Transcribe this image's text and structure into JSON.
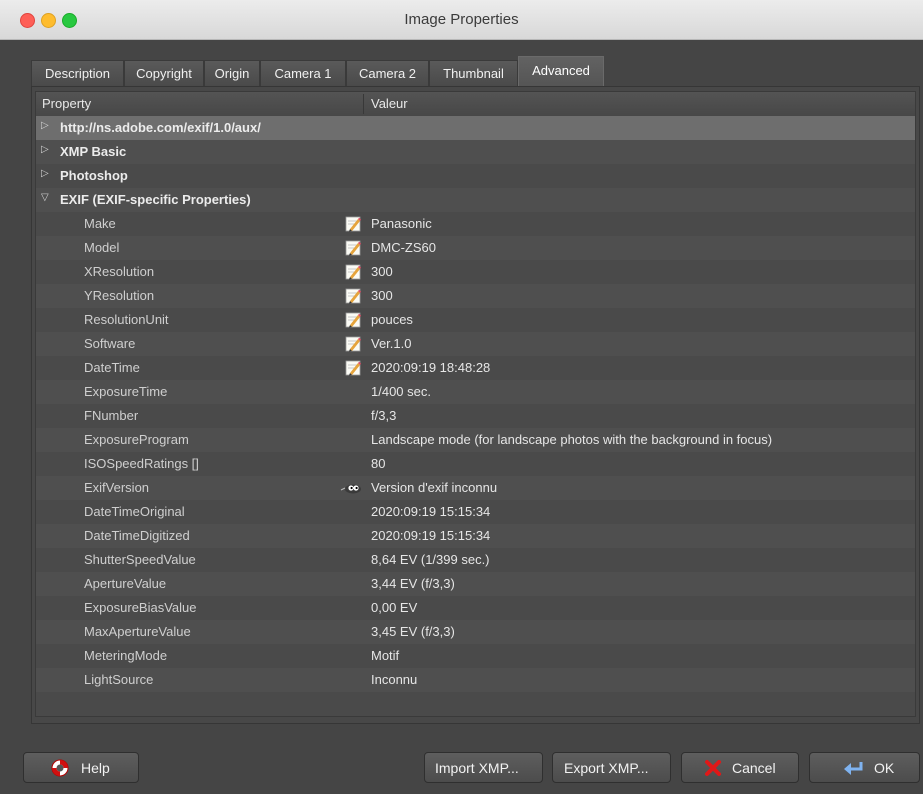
{
  "window": {
    "title": "Image Properties"
  },
  "tabs": [
    {
      "label": "Description",
      "active": false
    },
    {
      "label": "Copyright",
      "active": false
    },
    {
      "label": "Origin",
      "active": false
    },
    {
      "label": "Camera 1",
      "active": false
    },
    {
      "label": "Camera 2",
      "active": false
    },
    {
      "label": "Thumbnail",
      "active": false
    },
    {
      "label": "Advanced",
      "active": true
    }
  ],
  "table": {
    "columns": {
      "property": "Property",
      "value": "Valeur"
    },
    "groups": [
      {
        "label": "http://ns.adobe.com/exif/1.0/aux/",
        "expanded": false,
        "selected": true
      },
      {
        "label": "XMP Basic",
        "expanded": false
      },
      {
        "label": "Photoshop",
        "expanded": false
      },
      {
        "label": "EXIF (EXIF-specific Properties)",
        "expanded": true
      }
    ],
    "rows": [
      {
        "property": "Make",
        "value": "Panasonic",
        "icon": "edit-icon"
      },
      {
        "property": "Model",
        "value": "DMC-ZS60",
        "icon": "edit-icon"
      },
      {
        "property": "XResolution",
        "value": "300",
        "icon": "edit-icon"
      },
      {
        "property": "YResolution",
        "value": "300",
        "icon": "edit-icon"
      },
      {
        "property": "ResolutionUnit",
        "value": "pouces",
        "icon": "edit-icon"
      },
      {
        "property": "Software",
        "value": "Ver.1.0",
        "icon": "edit-icon"
      },
      {
        "property": "DateTime",
        "value": "2020:09:19 18:48:28",
        "icon": "edit-icon"
      },
      {
        "property": "ExposureTime",
        "value": "1/400 sec."
      },
      {
        "property": "FNumber",
        "value": "f/3,3"
      },
      {
        "property": "ExposureProgram",
        "value": "Landscape mode (for landscape photos with the background in focus)"
      },
      {
        "property": "ISOSpeedRatings []",
        "value": "80"
      },
      {
        "property": "ExifVersion",
        "value": "Version d'exif inconnu",
        "icon": "wilber-warning-icon"
      },
      {
        "property": "DateTimeOriginal",
        "value": "2020:09:19 15:15:34"
      },
      {
        "property": "DateTimeDigitized",
        "value": "2020:09:19 15:15:34"
      },
      {
        "property": "ShutterSpeedValue",
        "value": "8,64 EV (1/399 sec.)"
      },
      {
        "property": "ApertureValue",
        "value": "3,44 EV (f/3,3)"
      },
      {
        "property": "ExposureBiasValue",
        "value": "0,00 EV"
      },
      {
        "property": "MaxApertureValue",
        "value": "3,45 EV (f/3,3)"
      },
      {
        "property": "MeteringMode",
        "value": "Motif"
      },
      {
        "property": "LightSource",
        "value": "Inconnu"
      }
    ]
  },
  "buttons": {
    "help": "Help",
    "import_xmp": "Import XMP...",
    "export_xmp": "Export XMP...",
    "cancel": "Cancel",
    "ok": "OK"
  },
  "icons": {
    "help": "lifebuoy-icon",
    "cancel": "red-x-icon",
    "ok": "enter-arrow-icon",
    "edit": "edit-icon",
    "warning": "wilber-warning-icon"
  },
  "colors": {
    "background": "#454545",
    "selected_row": "#6e6e6e",
    "close": "#fe5f57",
    "minimize": "#febc2e",
    "maximize": "#28c840"
  }
}
